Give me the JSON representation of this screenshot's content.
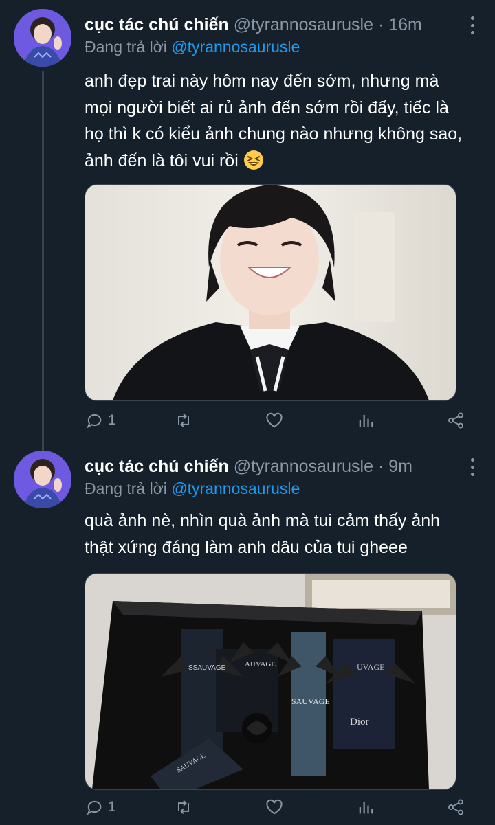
{
  "tweets": [
    {
      "name": "cục tác chú chiến",
      "handle": "@tyrannosaurusle",
      "dot": "·",
      "time": "16m",
      "replying_label": "Đang trả lời",
      "replying_handle": "@tyrannosaurusle",
      "text": "anh đẹp trai này hôm nay đến sớm, nhưng mà mọi người biết ai rủ ảnh đến sớm rồi đấy, tiếc là họ thì k có kiểu ảnh chung nào nhưng không sao, ảnh đến là tôi vui rồi",
      "emoji": "grinning-squinting-face-emoji",
      "media": "photo-smiling-man-black-suit",
      "reply_count": "1",
      "retweet_count": "",
      "like_count": ""
    },
    {
      "name": "cục tác chú chiến",
      "handle": "@tyrannosaurusle",
      "dot": "·",
      "time": "9m",
      "replying_label": "Đang trả lời",
      "replying_handle": "@tyrannosaurusle",
      "text": "quà ảnh nè, nhìn quà ảnh mà tui cảm thấy ảnh thật xứng đáng làm anh dâu của tui gheee",
      "media": "photo-dior-sauvage-gift-box",
      "reply_count": "1",
      "retweet_count": "",
      "like_count": ""
    }
  ],
  "gift_box_labels": {
    "brand": "Dior",
    "product": "SAUVAGE",
    "product_partial": "UVAGE",
    "product_partial2": "AUVAGE"
  },
  "icons": [
    "reply-icon",
    "retweet-icon",
    "like-icon",
    "analytics-icon",
    "share-icon",
    "more-icon"
  ],
  "colors": {
    "background": "#15202b",
    "secondary_text": "#8b98a5",
    "link": "#1d9bf0",
    "thread_line": "#38444d"
  }
}
